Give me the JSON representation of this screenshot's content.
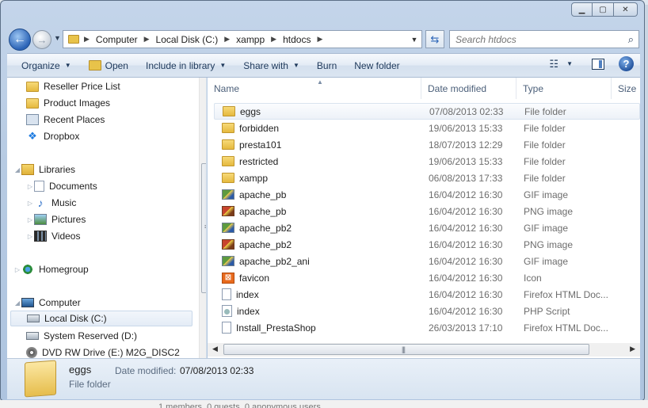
{
  "window": {
    "caption": {
      "minimize": "▁",
      "maximize": "▢",
      "close": "✕"
    }
  },
  "nav": {
    "back_icon": "back-arrow-icon",
    "forward_icon": "forward-arrow-icon",
    "breadcrumb": [
      "Computer",
      "Local Disk (C:)",
      "xampp",
      "htdocs"
    ],
    "search_placeholder": "Search htdocs"
  },
  "toolbar": {
    "organize": "Organize",
    "open": "Open",
    "include_in_library": "Include in library",
    "share_with": "Share with",
    "burn": "Burn",
    "new_folder": "New folder"
  },
  "sidebar": {
    "items": [
      {
        "label": "Reseller Price List",
        "icon": "folder"
      },
      {
        "label": "Product Images",
        "icon": "folder"
      },
      {
        "label": "Recent Places",
        "icon": "recent"
      },
      {
        "label": "Dropbox",
        "icon": "dropbox"
      },
      {
        "label": "Libraries",
        "icon": "libraries"
      },
      {
        "label": "Documents",
        "icon": "doc"
      },
      {
        "label": "Music",
        "icon": "music"
      },
      {
        "label": "Pictures",
        "icon": "pictures"
      },
      {
        "label": "Videos",
        "icon": "videos"
      },
      {
        "label": "Homegroup",
        "icon": "homegroup"
      },
      {
        "label": "Computer",
        "icon": "computer"
      },
      {
        "label": "Local Disk (C:)",
        "icon": "drive"
      },
      {
        "label": "System Reserved (D:)",
        "icon": "drive"
      },
      {
        "label": "DVD RW Drive (E:) M2G_DISC2",
        "icon": "dvd"
      }
    ]
  },
  "columns": {
    "name": "Name",
    "date_modified": "Date modified",
    "type": "Type",
    "size": "Size"
  },
  "files": [
    {
      "name": "eggs",
      "date": "07/08/2013 02:33",
      "type": "File folder",
      "icon": "folder"
    },
    {
      "name": "forbidden",
      "date": "19/06/2013 15:33",
      "type": "File folder",
      "icon": "folder"
    },
    {
      "name": "presta101",
      "date": "18/07/2013 12:29",
      "type": "File folder",
      "icon": "folder"
    },
    {
      "name": "restricted",
      "date": "19/06/2013 15:33",
      "type": "File folder",
      "icon": "folder"
    },
    {
      "name": "xampp",
      "date": "06/08/2013 17:33",
      "type": "File folder",
      "icon": "folder"
    },
    {
      "name": "apache_pb",
      "date": "16/04/2012 16:30",
      "type": "GIF image",
      "icon": "gif"
    },
    {
      "name": "apache_pb",
      "date": "16/04/2012 16:30",
      "type": "PNG image",
      "icon": "png"
    },
    {
      "name": "apache_pb2",
      "date": "16/04/2012 16:30",
      "type": "GIF image",
      "icon": "gif"
    },
    {
      "name": "apache_pb2",
      "date": "16/04/2012 16:30",
      "type": "PNG image",
      "icon": "png"
    },
    {
      "name": "apache_pb2_ani",
      "date": "16/04/2012 16:30",
      "type": "GIF image",
      "icon": "gif"
    },
    {
      "name": "favicon",
      "date": "16/04/2012 16:30",
      "type": "Icon",
      "icon": "favicon"
    },
    {
      "name": "index",
      "date": "16/04/2012 16:30",
      "type": "Firefox HTML Doc...",
      "icon": "html"
    },
    {
      "name": "index",
      "date": "16/04/2012 16:30",
      "type": "PHP Script",
      "icon": "php"
    },
    {
      "name": "Install_PrestaShop",
      "date": "26/03/2013 17:10",
      "type": "Firefox HTML Doc...",
      "icon": "html"
    }
  ],
  "details": {
    "name": "eggs",
    "date_label": "Date modified:",
    "date_value": "07/08/2013 02:33",
    "type": "File folder"
  },
  "background_text": "1 members, 0 guests, 0 anonymous users"
}
